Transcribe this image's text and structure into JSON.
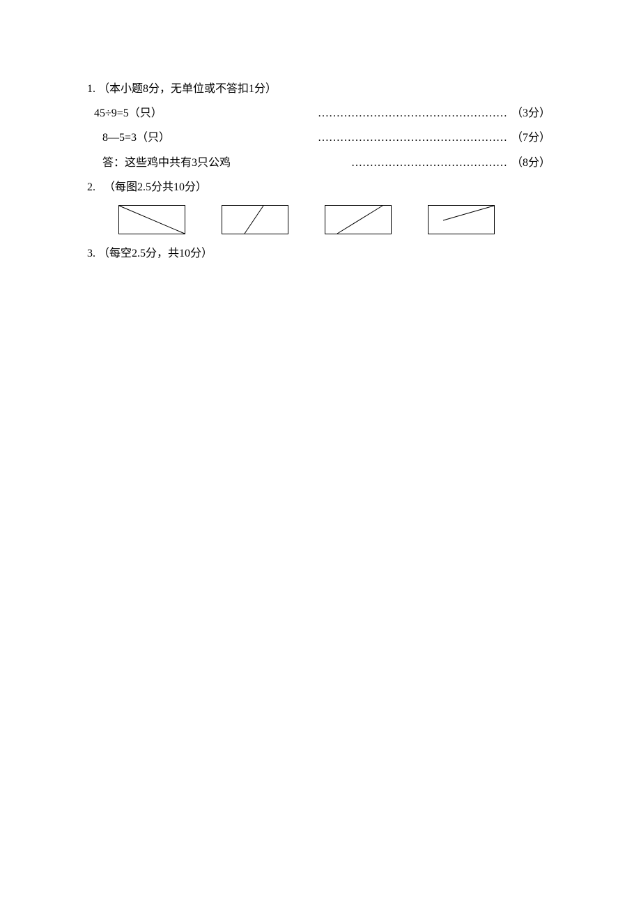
{
  "q1": {
    "num": "1.",
    "header": "（本小题8分，无单位或不答扣1分）",
    "step1_eq": "45÷9=5（只）",
    "step1_pts": "（3分）",
    "step2_eq": "8—5=3（只）",
    "step2_pts": "（7分）",
    "answer_label": "答：",
    "answer_text": "这些鸡中共有3只公鸡",
    "answer_pts": "（8分）"
  },
  "q2": {
    "num": "2.",
    "header": "（每图2.5分共10分）"
  },
  "q3": {
    "num": "3.",
    "header": "（每空2.5分，共10分）"
  }
}
